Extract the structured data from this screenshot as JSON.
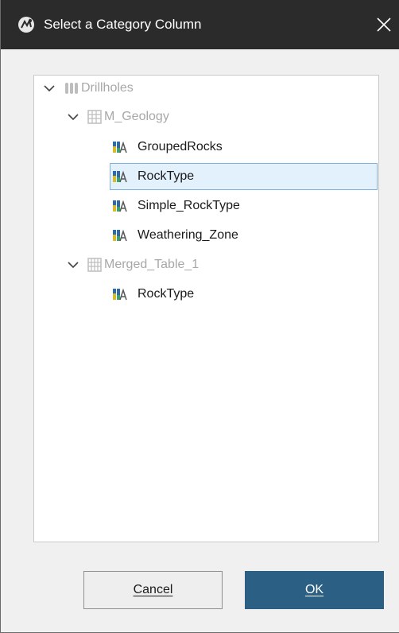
{
  "window": {
    "title": "Select a Category Column",
    "close_icon": "close-icon"
  },
  "tree": {
    "root": {
      "label": "Drillholes",
      "icon": "drillholes-icon",
      "expanded": true
    },
    "tables": [
      {
        "label": "M_Geology",
        "icon": "table-icon",
        "expanded": true,
        "columns": [
          {
            "label": "GroupedRocks",
            "icon": "category-column-icon"
          },
          {
            "label": "RockType",
            "icon": "category-column-icon",
            "selected": true
          },
          {
            "label": "Simple_RockType",
            "icon": "category-column-icon"
          },
          {
            "label": "Weathering_Zone",
            "icon": "category-column-icon"
          }
        ]
      },
      {
        "label": "Merged_Table_1",
        "icon": "merged-table-icon",
        "expanded": true,
        "columns": [
          {
            "label": "RockType",
            "icon": "category-column-icon"
          }
        ]
      }
    ]
  },
  "buttons": {
    "cancel_label": "Cancel",
    "ok_label": "OK"
  },
  "colors": {
    "titlebar": "#2b2b2b",
    "ok_button": "#2c5f84",
    "selection_fill": "#e3f1fc",
    "selection_border": "#7fb2dd",
    "column_icon_blue": "#2f6aa8",
    "column_icon_yellow": "#d9b92d",
    "column_icon_green": "#3aa36a"
  }
}
